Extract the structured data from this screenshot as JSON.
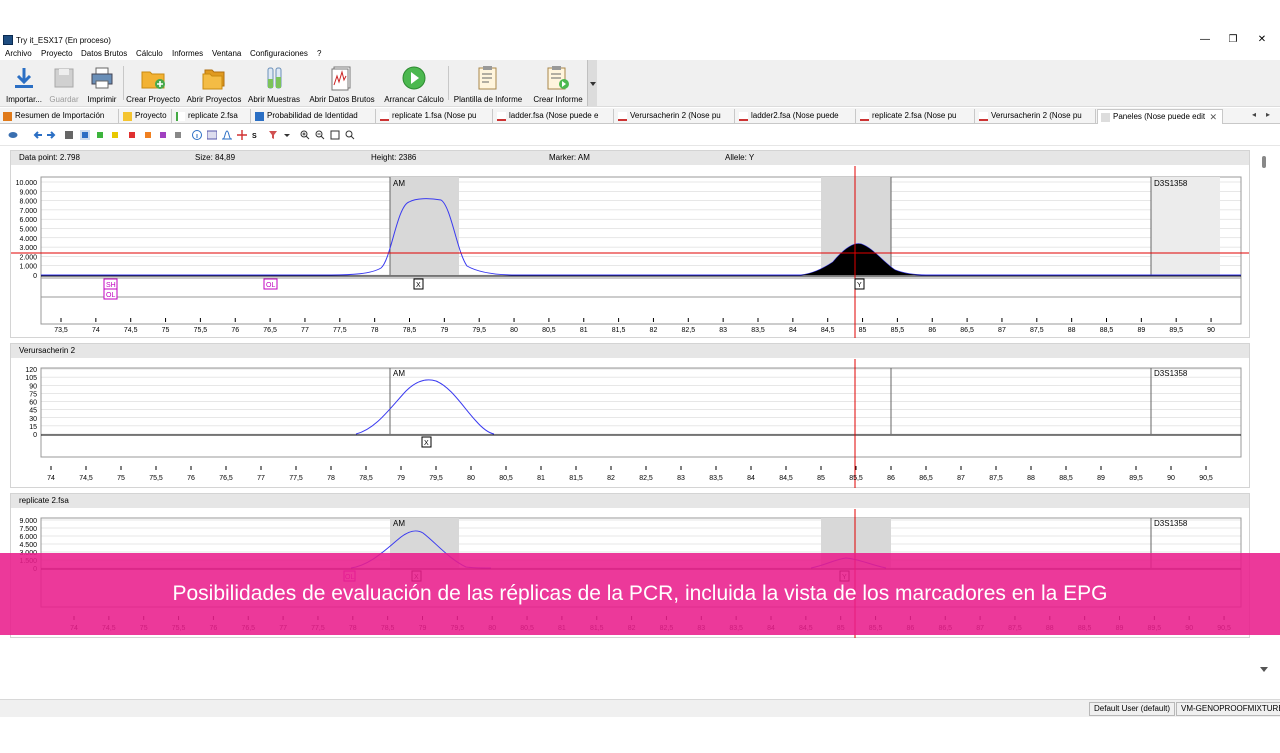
{
  "window": {
    "title": "Try it_ESX17 (En proceso)",
    "minimize": "—",
    "maximize": "❐",
    "close": "✕"
  },
  "menu": [
    "Archivo",
    "Proyecto",
    "Datos Brutos",
    "Cálculo",
    "Informes",
    "Ventana",
    "Configuraciones",
    "?"
  ],
  "toolbar": [
    {
      "label": "Importar...",
      "icon": "import-icon",
      "enabled": true
    },
    {
      "label": "Guardar",
      "icon": "save-icon",
      "enabled": false
    },
    {
      "label": "Imprimir",
      "icon": "print-icon",
      "enabled": true
    },
    {
      "label": "Crear Proyecto",
      "icon": "new-project-icon",
      "enabled": true
    },
    {
      "label": "Abrir Proyectos",
      "icon": "open-projects-icon",
      "enabled": true
    },
    {
      "label": "Abrir Muestras",
      "icon": "open-samples-icon",
      "enabled": true
    },
    {
      "label": "Abrir Datos Brutos",
      "icon": "open-raw-data-icon",
      "enabled": true
    },
    {
      "label": "Arrancar Cálculo",
      "icon": "start-calculation-icon",
      "enabled": true
    },
    {
      "label": "Plantilla de Informe",
      "icon": "report-template-icon",
      "enabled": true
    },
    {
      "label": "Crear Informe",
      "icon": "create-report-icon",
      "enabled": true
    }
  ],
  "tabs": [
    {
      "label": "Resumen de Importación",
      "icon": "import-summary-icon"
    },
    {
      "label": "Proyecto",
      "icon": "project-icon"
    },
    {
      "label": "replicate 2.fsa",
      "icon": "fsa-file-icon"
    },
    {
      "label": "Probabilidad de Identidad",
      "icon": "id-icon"
    },
    {
      "label": "replicate 1.fsa (Nose pu",
      "icon": "fsa-file-icon"
    },
    {
      "label": "ladder.fsa (Nose puede e",
      "icon": "fsa-file-icon"
    },
    {
      "label": "Verursacherin 2 (Nose pu",
      "icon": "fsa-file-icon"
    },
    {
      "label": "ladder2.fsa (Nose puede",
      "icon": "fsa-file-icon"
    },
    {
      "label": "replicate 2.fsa (Nose pu",
      "icon": "fsa-file-icon"
    },
    {
      "label": "Verursacherin 2 (Nose pu",
      "icon": "fsa-file-icon"
    },
    {
      "label": "Paneles (Nose puede edit",
      "icon": "panels-icon",
      "active": true
    }
  ],
  "tab_close": "✕",
  "info_bar": {
    "data_point": "Data point: 2.798",
    "size": "Size: 84,89",
    "height": "Height: 2386",
    "marker": "Marker: AM",
    "allele": "Allele: Y"
  },
  "panels": [
    {
      "name": "",
      "marker1": "AM",
      "marker2": "D3S1358",
      "yticks": [
        "10.000",
        "9.000",
        "8.000",
        "7.000",
        "6.000",
        "5.000",
        "4.000",
        "3.000",
        "2.000",
        "1.000",
        "0"
      ],
      "xticks": [
        "73,5",
        "74",
        "74,5",
        "75",
        "75,5",
        "76",
        "76,5",
        "77",
        "77,5",
        "78",
        "78,5",
        "79",
        "79,5",
        "80",
        "80,5",
        "81",
        "81,5",
        "82",
        "82,5",
        "83",
        "83,5",
        "84",
        "84,5",
        "85",
        "85,5",
        "86",
        "86,5",
        "87",
        "87,5",
        "88",
        "88,5",
        "89",
        "89,5",
        "90"
      ],
      "labels": [
        "SH",
        "OL",
        "OL",
        "X",
        "Y"
      ]
    },
    {
      "name": "Verursacherin 2",
      "marker1": "AM",
      "marker2": "D3S1358",
      "yticks": [
        "120",
        "105",
        "90",
        "75",
        "60",
        "45",
        "30",
        "15",
        "0"
      ],
      "xticks": [
        "74",
        "74,5",
        "75",
        "75,5",
        "76",
        "76,5",
        "77",
        "77,5",
        "78",
        "78,5",
        "79",
        "79,5",
        "80",
        "80,5",
        "81",
        "81,5",
        "82",
        "82,5",
        "83",
        "83,5",
        "84",
        "84,5",
        "85",
        "85,5",
        "86",
        "86,5",
        "87",
        "87,5",
        "88",
        "88,5",
        "89",
        "89,5",
        "90",
        "90,5"
      ],
      "labels": [
        "X"
      ]
    },
    {
      "name": "replicate 2.fsa",
      "marker1": "AM",
      "marker2": "D3S1358",
      "yticks": [
        "9.000",
        "7.500",
        "6.000",
        "4.500",
        "3.000",
        "1.500",
        "0"
      ],
      "xticks": [
        "74",
        "74,5",
        "75",
        "75,5",
        "76",
        "76,5",
        "77",
        "77,5",
        "78",
        "78,5",
        "79",
        "79,5",
        "80",
        "80,5",
        "81",
        "81,5",
        "82",
        "82,5",
        "83",
        "83,5",
        "84",
        "84,5",
        "85",
        "85,5",
        "86",
        "86,5",
        "87",
        "87,5",
        "88",
        "88,5",
        "89",
        "89,5",
        "90",
        "90,5"
      ],
      "labels": [
        "OL",
        "X",
        "Y"
      ]
    }
  ],
  "banner": "Posibilidades de evaluación de las réplicas de la PCR, incluida la vista de los marcadores en la EPG",
  "status": {
    "user": "Default User (default)",
    "db": "VM-GENOPROOFMIXTURE"
  },
  "colors": {
    "accent_banner": "#e91e8c",
    "trace": "#3a3af0",
    "cursor": "#e00000",
    "marker_bg": "#d8d8d8",
    "label": "#c000c0"
  }
}
